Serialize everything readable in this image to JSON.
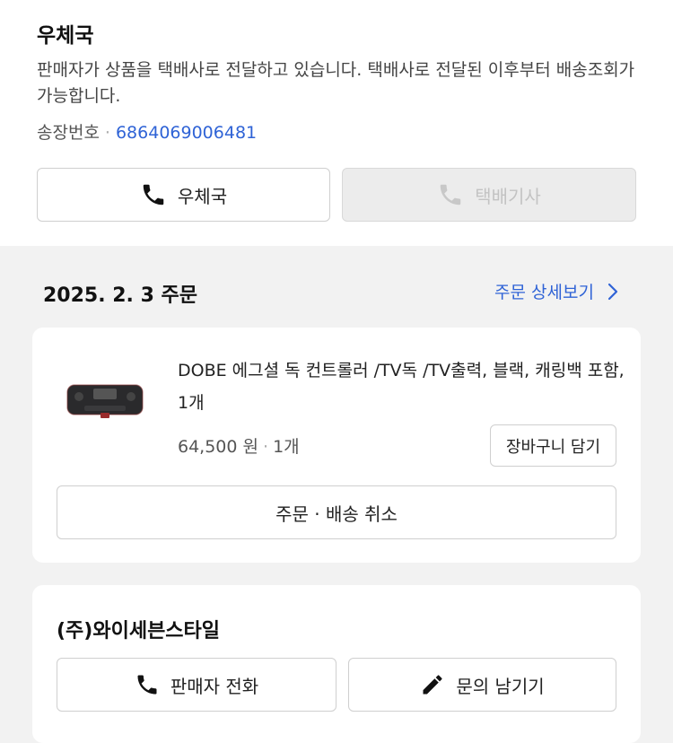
{
  "delivery": {
    "carrier_title": "우체국",
    "message": "판매자가 상품을 택배사로 전달하고 있습니다. 택배사로 전달된 이후부터 배송조회가 가능합니다.",
    "tracking_label": "송장번호",
    "tracking_separator": "·",
    "tracking_number": "6864069006481",
    "carrier_button_label": "우체국",
    "courier_button_label": "택배기사",
    "icons": {
      "call": "phone-icon"
    }
  },
  "order": {
    "date_title": "2025. 2. 3 주문",
    "detail_link": "주문 상세보기",
    "product": {
      "name": "DOBE 에그셜 독 컨트롤러 /TV독 /TV출력, 블랙, 캐링백 포함, 1개",
      "price": "64,500 원",
      "separator": "·",
      "quantity": "1개",
      "cart_button": "장바구니 담기"
    },
    "cancel_button": "주문 · 배송 취소"
  },
  "seller": {
    "name": "(주)와이세븐스타일",
    "call_button": "판매자 전화",
    "inquiry_button": "문의 남기기",
    "icons": {
      "call": "phone-icon",
      "inquiry": "pencil-icon"
    }
  },
  "colors": {
    "accent": "#2f63d6",
    "page_background": "#f2f2f2",
    "disabled_button": "#ececec"
  }
}
